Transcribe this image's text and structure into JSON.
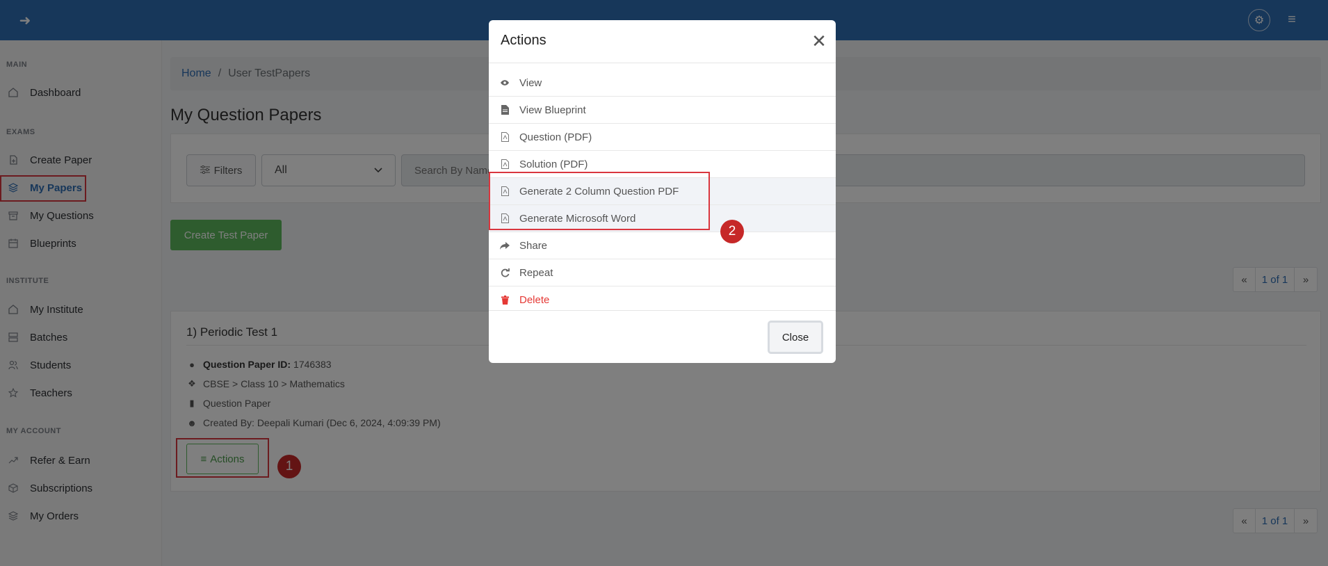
{
  "header": {
    "back_icon": "arrow-left-icon",
    "settings_icon": "gear-icon",
    "menu_icon": "hamburger-icon"
  },
  "sidebar": {
    "sections": [
      {
        "title": "MAIN",
        "items": [
          {
            "label": "Dashboard",
            "icon": "home-icon"
          }
        ]
      },
      {
        "title": "EXAMS",
        "items": [
          {
            "label": "Create Paper",
            "icon": "file-plus-icon"
          },
          {
            "label": "My Papers",
            "icon": "layers-icon",
            "active": true
          },
          {
            "label": "My Questions",
            "icon": "archive-icon"
          },
          {
            "label": "Blueprints",
            "icon": "calendar-icon"
          }
        ]
      },
      {
        "title": "INSTITUTE",
        "items": [
          {
            "label": "My Institute",
            "icon": "home-icon"
          },
          {
            "label": "Batches",
            "icon": "server-icon"
          },
          {
            "label": "Students",
            "icon": "users-icon"
          },
          {
            "label": "Teachers",
            "icon": "star-icon"
          }
        ]
      },
      {
        "title": "MY ACCOUNT",
        "items": [
          {
            "label": "Refer & Earn",
            "icon": "trending-up-icon"
          },
          {
            "label": "Subscriptions",
            "icon": "box-icon"
          },
          {
            "label": "My Orders",
            "icon": "layers-icon"
          }
        ]
      }
    ]
  },
  "breadcrumb": {
    "home": "Home",
    "separator": "/",
    "current": "User TestPapers"
  },
  "page_title": "My Question Papers",
  "filters": {
    "filters_label": "Filters",
    "select_value": "All",
    "search_placeholder": "Search By Name"
  },
  "create_button": "Create Test Paper",
  "pagination": {
    "prev": "«",
    "page": "1 of 1",
    "next": "»"
  },
  "paper": {
    "title": "1) Periodic Test 1",
    "id_label": "Question Paper ID:",
    "id_value": "1746383",
    "path": "CBSE > Class 10 > Mathematics",
    "type": "Question Paper",
    "created": "Created By: Deepali Kumari (Dec 6, 2024, 4:09:39 PM)",
    "actions_label": "Actions"
  },
  "annotations": {
    "step1": "1",
    "step2": "2"
  },
  "modal": {
    "title": "Actions",
    "close_label": "Close",
    "items": [
      {
        "label": "View",
        "icon": "eye-icon"
      },
      {
        "label": "View Blueprint",
        "icon": "document-icon"
      },
      {
        "label": "Question (PDF)",
        "icon": "pdf-icon"
      },
      {
        "label": "Solution (PDF)",
        "icon": "pdf-icon"
      },
      {
        "label": "Generate 2 Column Question PDF",
        "icon": "pdf-icon"
      },
      {
        "label": "Generate Microsoft Word",
        "icon": "pdf-icon"
      },
      {
        "label": "Share",
        "icon": "share-icon"
      },
      {
        "label": "Repeat",
        "icon": "refresh-icon"
      },
      {
        "label": "Delete",
        "icon": "trash-icon"
      }
    ]
  },
  "colors": {
    "primary": "#2f6eb5",
    "success": "#5cb85c",
    "danger": "#e53935",
    "annotation": "#c62828"
  }
}
